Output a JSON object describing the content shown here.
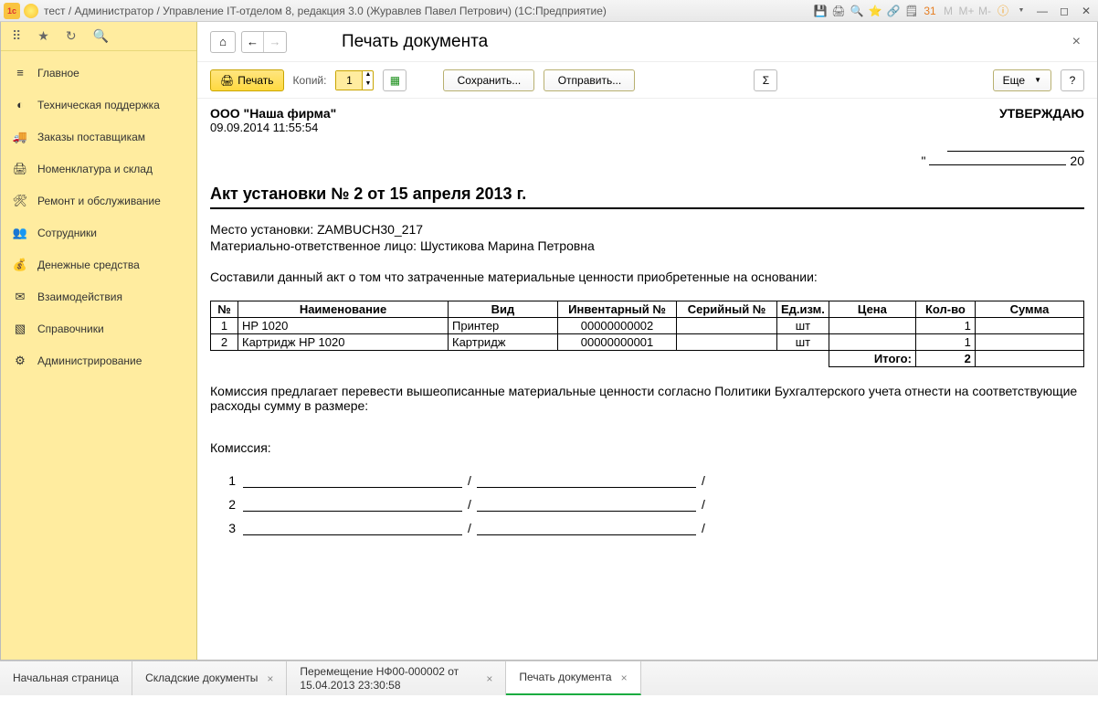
{
  "titlebar": {
    "title": "тест / Администратор / Управление IT-отделом 8, редакция 3.0 (Журавлев Павел Петрович)  (1С:Предприятие)"
  },
  "sidebar": {
    "items": [
      {
        "icon": "≡",
        "label": "Главное"
      },
      {
        "icon": "◐",
        "label": "Техническая поддержка"
      },
      {
        "icon": "🚚",
        "label": "Заказы поставщикам"
      },
      {
        "icon": "🖨",
        "label": "Номенклатура и склад"
      },
      {
        "icon": "🛠",
        "label": "Ремонт и обслуживание"
      },
      {
        "icon": "👥",
        "label": "Сотрудники"
      },
      {
        "icon": "💰",
        "label": "Денежные средства"
      },
      {
        "icon": "✉",
        "label": "Взаимодействия"
      },
      {
        "icon": "▧",
        "label": "Справочники"
      },
      {
        "icon": "⚙",
        "label": "Администрирование"
      }
    ]
  },
  "header": {
    "page_title": "Печать документа"
  },
  "toolbar": {
    "print": "Печать",
    "copies_label": "Копий:",
    "copies_value": "1",
    "save": "Сохранить...",
    "send": "Отправить...",
    "sum": "Σ",
    "more": "Еще",
    "help": "?"
  },
  "doc": {
    "company": "ООО \"Наша фирма\"",
    "datetime": "09.09.2014 11:55:54",
    "approve": "УТВЕРЖДАЮ",
    "approve_quote": "\"",
    "approve_year": "20",
    "title": "Акт установки № 2 от 15 апреля 2013 г.",
    "place_label": "Место установки: ",
    "place_value": "ZAMBUCH30_217",
    "resp_label": "Материально-ответственное лицо: ",
    "resp_value": "Шустикова Марина Петровна",
    "desc": "Составили данный акт о том что затраченные материальные ценности приобретенные на основании:",
    "table": {
      "headers": [
        "№",
        "Наименование",
        "Вид",
        "Инвентарный №",
        "Серийный №",
        "Ед.изм.",
        "Цена",
        "Кол-во",
        "Сумма"
      ],
      "rows": [
        {
          "n": "1",
          "name": "HP 1020",
          "kind": "Принтер",
          "inv": "00000000002",
          "ser": "",
          "unit": "шт",
          "price": "",
          "qty": "1",
          "sum": ""
        },
        {
          "n": "2",
          "name": "Картридж HP 1020",
          "kind": "Картридж",
          "inv": "00000000001",
          "ser": "",
          "unit": "шт",
          "price": "",
          "qty": "1",
          "sum": ""
        }
      ],
      "total_label": "Итого:",
      "total_qty": "2"
    },
    "footer_desc": "Комиссия предлагает перевести вышеописанные материальные ценности согласно Политики Бухгалтерского учета отнести на соответствующие расходы сумму в размере:",
    "commission_label": "Комиссия:",
    "sign_rows": [
      "1",
      "2",
      "3"
    ]
  },
  "tabs": [
    {
      "label": "Начальная страница",
      "closable": false
    },
    {
      "label": "Складские документы",
      "closable": true
    },
    {
      "label": "Перемещение НФ00-000002 от 15.04.2013 23:30:58",
      "closable": true
    },
    {
      "label": "Печать документа",
      "closable": true,
      "active": true
    }
  ]
}
